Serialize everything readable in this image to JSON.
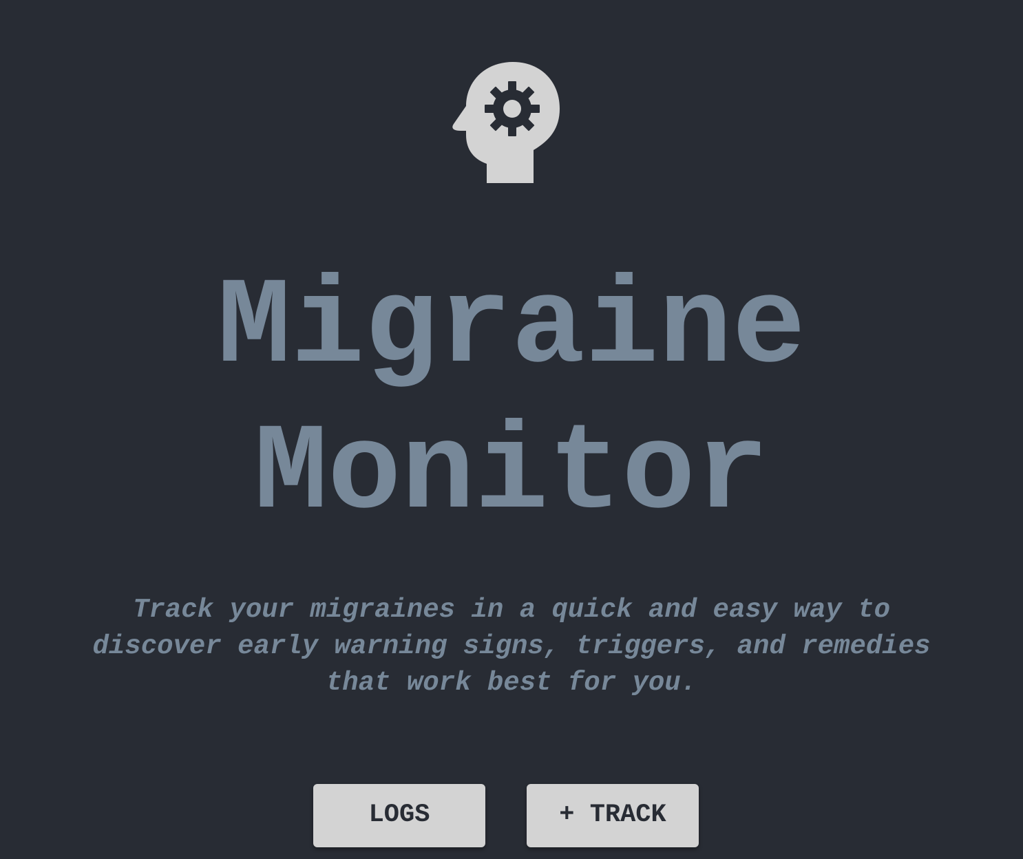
{
  "app": {
    "title_line1": "Migraine",
    "title_line2": "Monitor",
    "tagline_line1": "Track your migraines in a quick and easy way to",
    "tagline_line2": "discover early warning signs, triggers, and remedies",
    "tagline_line3": "that work best for you."
  },
  "logo": {
    "icon": "head-with-gear-icon"
  },
  "actions": {
    "logs_label": "LOGS",
    "track_label": "+ TRACK"
  },
  "colors": {
    "background": "#282c34",
    "text": "#778899",
    "button_bg": "#d3d3d3",
    "button_text": "#282c34",
    "icon": "#d3d3d3"
  }
}
